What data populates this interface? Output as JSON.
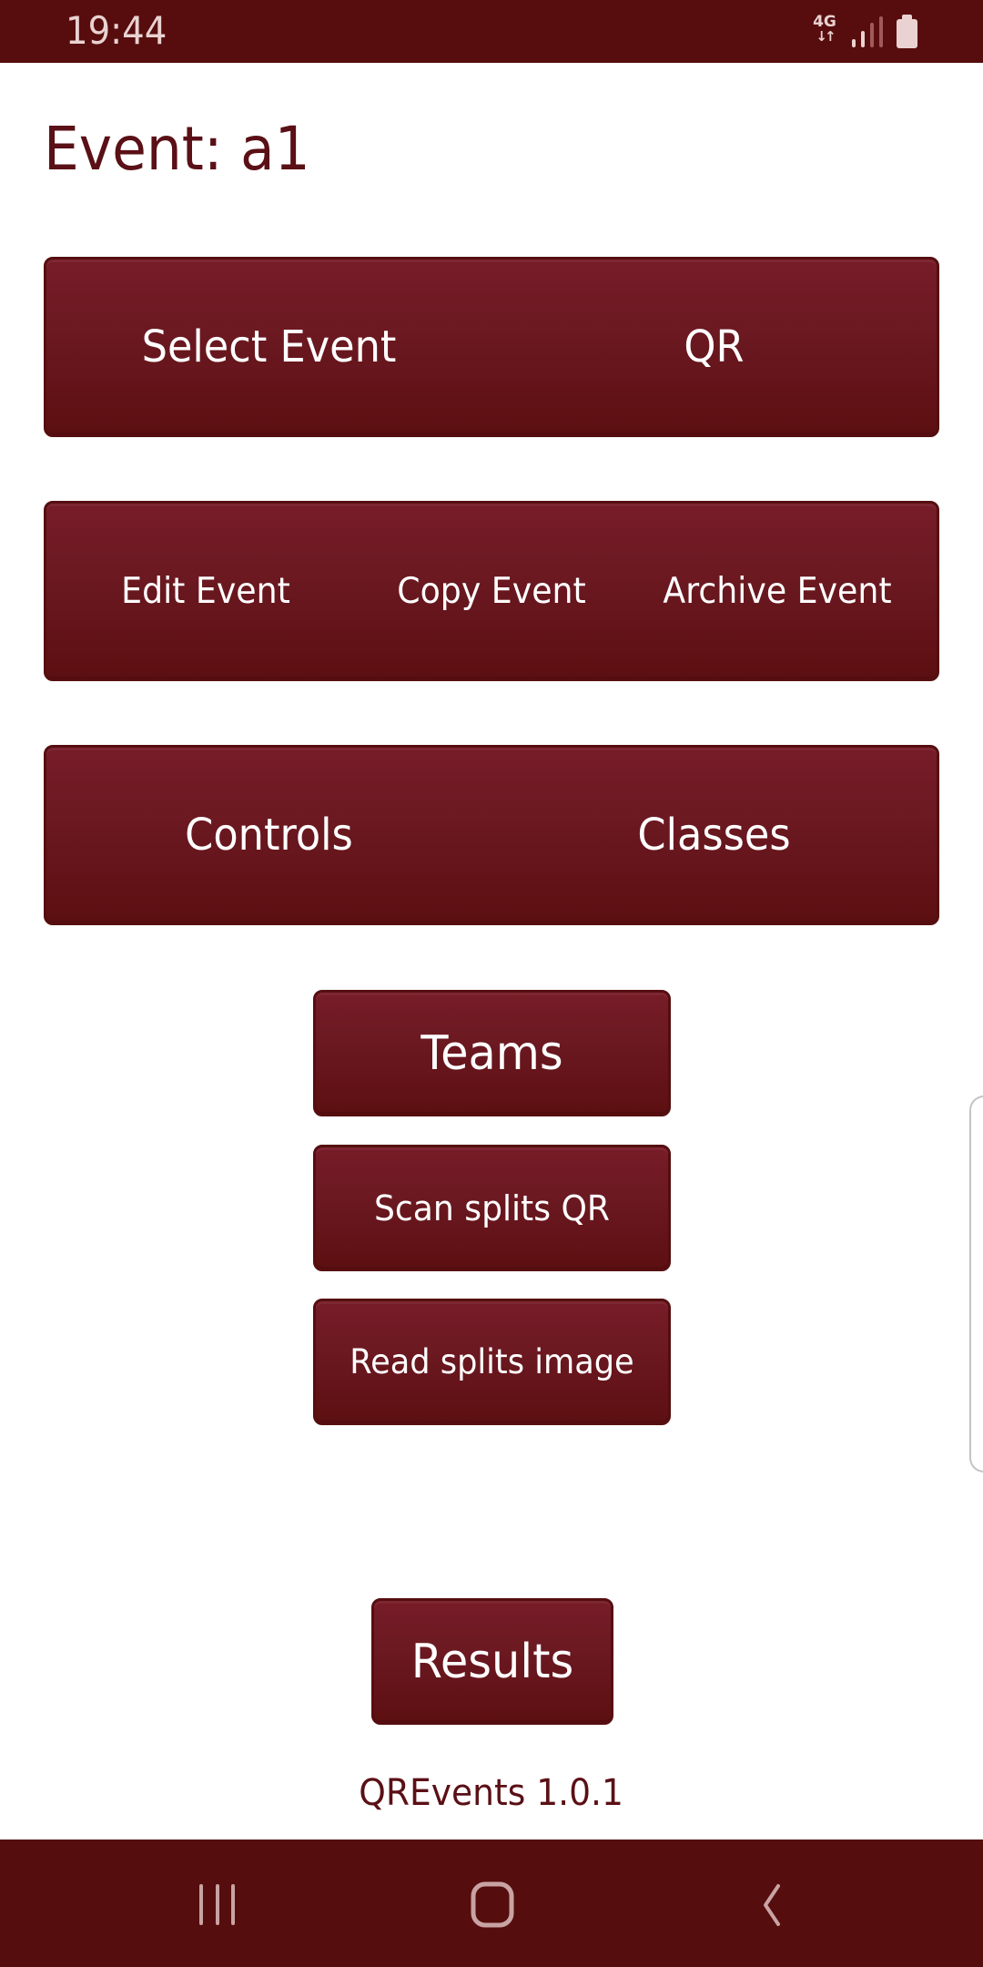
{
  "status_bar": {
    "time": "19:44",
    "network_type": "4G",
    "network_arrows": "↓↑",
    "signal_bars_filled": 2,
    "signal_bars_total": 4,
    "icons": [
      "network-4g-icon",
      "signal-strength-icon",
      "battery-icon"
    ]
  },
  "header": {
    "title": "Event: a1"
  },
  "buttons": {
    "row1": {
      "select_event": "Select Event",
      "qr": "QR"
    },
    "row2": {
      "edit_event": "Edit Event",
      "copy_event": "Copy Event",
      "archive_event": "Archive Event"
    },
    "row3": {
      "controls": "Controls",
      "classes": "Classes"
    },
    "teams": "Teams",
    "scan_splits_qr": "Scan splits QR",
    "read_splits_image": "Read splits image",
    "results": "Results"
  },
  "footer": {
    "version": "QREvents 1.0.1"
  },
  "nav_bar": {
    "items": [
      "recent-apps",
      "home",
      "back"
    ]
  },
  "colors": {
    "brand_dark": "#570d0d",
    "button_top": "#761c28",
    "button_bottom": "#5c0f11",
    "title_text": "#5a1016",
    "status_icon": "#ead2d2",
    "nav_icon": "#c9a3a3"
  }
}
